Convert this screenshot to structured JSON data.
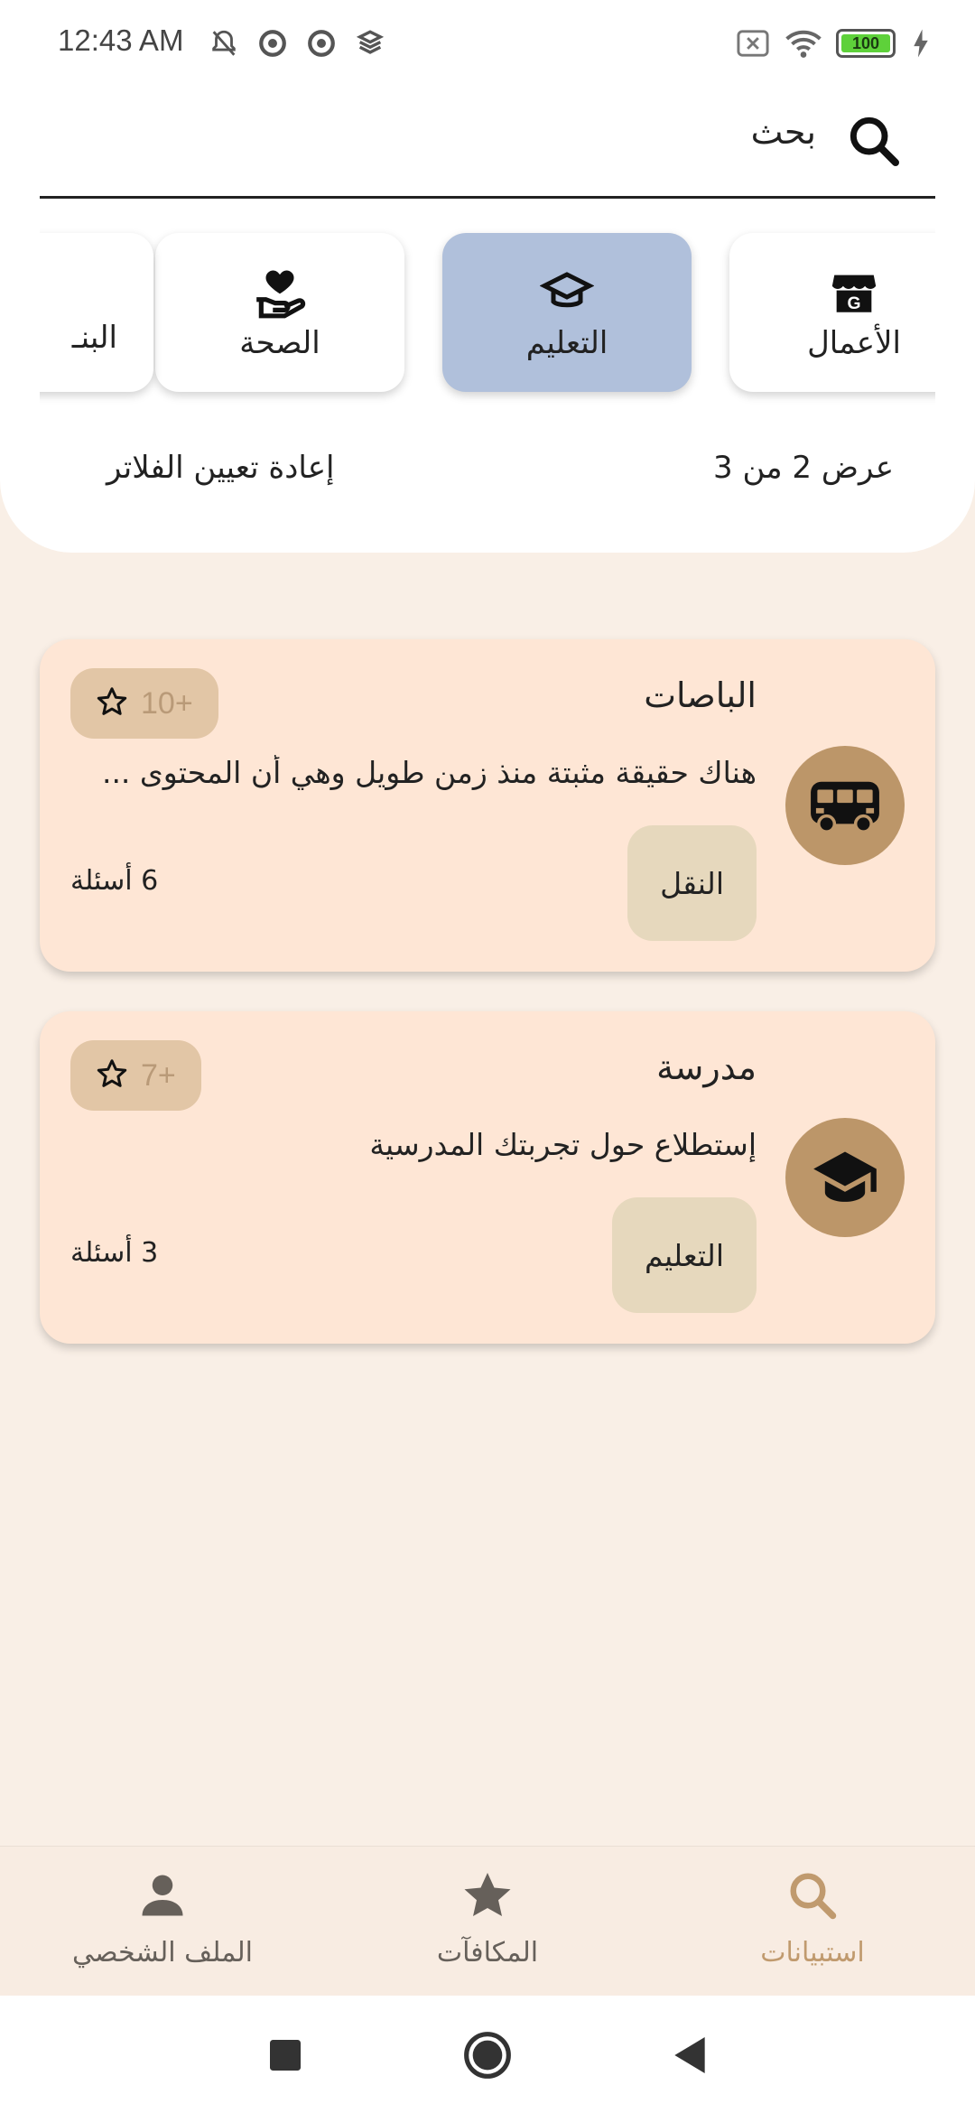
{
  "status_bar": {
    "time": "12:43 AM",
    "battery": "100",
    "icons": [
      "mute-bell-icon",
      "sync-icon",
      "sync-icon",
      "dropbox-icon",
      "no-sim-icon",
      "wifi-icon",
      "battery-icon",
      "charging-icon"
    ]
  },
  "search": {
    "label": "بحث",
    "icon": "search-icon"
  },
  "categories": [
    {
      "label": "الأعمال",
      "icon": "store-icon",
      "selected": false
    },
    {
      "label": "التعليم",
      "icon": "graduation-cap-icon",
      "selected": true
    },
    {
      "label": "الصحة",
      "icon": "heart-hand-icon",
      "selected": false
    },
    {
      "label": "البنـ",
      "icon": "",
      "selected": false
    }
  ],
  "filters": {
    "results_count": "عرض 2 من 3",
    "reset_label": "إعادة تعيين الفلاتر"
  },
  "surveys": [
    {
      "title": "الباصات",
      "description": "هناك حقيقة مثبتة منذ زمن طويل وهي أن المحتوى ...",
      "points": "10+",
      "category": "النقل",
      "questions": "6 أسئلة",
      "icon": "bus-icon"
    },
    {
      "title": "مدرسة",
      "description": "إستطلاع حول تجربتك المدرسية",
      "points": "7+",
      "category": "التعليم",
      "questions": "3 أسئلة",
      "icon": "graduation-cap-icon"
    }
  ],
  "bottom_nav": {
    "items": [
      {
        "label": "استبيانات",
        "icon": "search-icon",
        "active": true
      },
      {
        "label": "المكافآت",
        "icon": "star-icon",
        "active": false
      },
      {
        "label": "الملف الشخصي",
        "icon": "person-icon",
        "active": false
      }
    ]
  },
  "colors": {
    "background": "#f9efe6",
    "card": "#fee6d5",
    "selected_category": "#b0c0db",
    "accent": "#c09a6e",
    "avatar": "#bc9669"
  }
}
